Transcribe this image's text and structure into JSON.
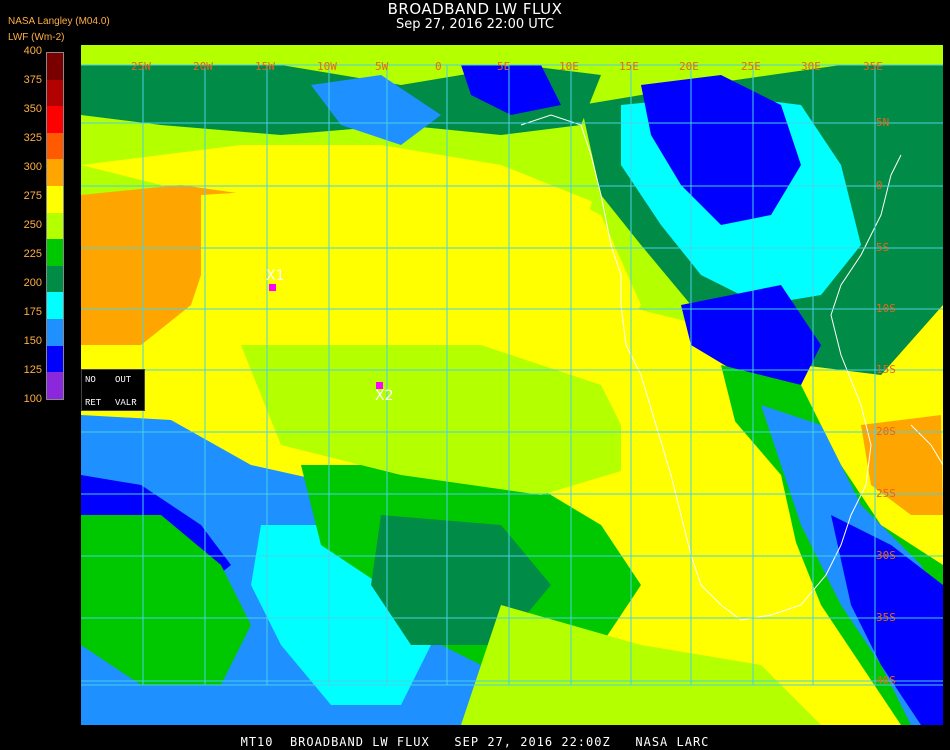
{
  "header": {
    "title": "BROADBAND LW FLUX",
    "datetime": "Sep 27, 2016 22:00 UTC",
    "org": "NASA Langley (M04.0)",
    "unit": "LWF (Wm-2)"
  },
  "legend": {
    "labels": [
      "400",
      "375",
      "350",
      "325",
      "300",
      "275",
      "250",
      "225",
      "200",
      "175",
      "150",
      "125",
      "100"
    ],
    "colors": [
      "#7a0000",
      "#b30000",
      "#ff0000",
      "#ff5a00",
      "#ffa500",
      "#ffff00",
      "#b4ff00",
      "#00c800",
      "#008c46",
      "#00ffff",
      "#1e90ff",
      "#0000ff",
      "#8c28dc"
    ]
  },
  "grid": {
    "lon_labels": [
      "25W",
      "20W",
      "15W",
      "10W",
      "5W",
      "0",
      "5E",
      "10E",
      "15E",
      "20E",
      "25E",
      "30E",
      "35E"
    ],
    "lat_labels": [
      "5N",
      "0",
      "5S",
      "10S",
      "15S",
      "20S",
      "25S",
      "30S",
      "35S",
      "40S"
    ],
    "color": "#48d1e6",
    "label_color": "#e8641b"
  },
  "markers": [
    {
      "label": "X1",
      "color": "#ff00ff"
    },
    {
      "label": "X2",
      "color": "#ff00ff"
    }
  ],
  "keybox": {
    "row1_left": "NO",
    "row1_right": "OUT",
    "row2_left": "RET",
    "row2_right": "VALR"
  },
  "footer": "MT10  BROADBAND LW FLUX   SEP 27, 2016 22:00Z   NASA LARC",
  "map_colors": {
    "yellow": "#ffff00",
    "lightgreen": "#b4ff00",
    "green": "#00c800",
    "darkgreen": "#008c46",
    "cyan": "#00ffff",
    "blue": "#1e90ff",
    "darkblue": "#0000ff",
    "purple": "#8c28dc",
    "orange": "#ffa500",
    "coast": "#ffffff"
  }
}
